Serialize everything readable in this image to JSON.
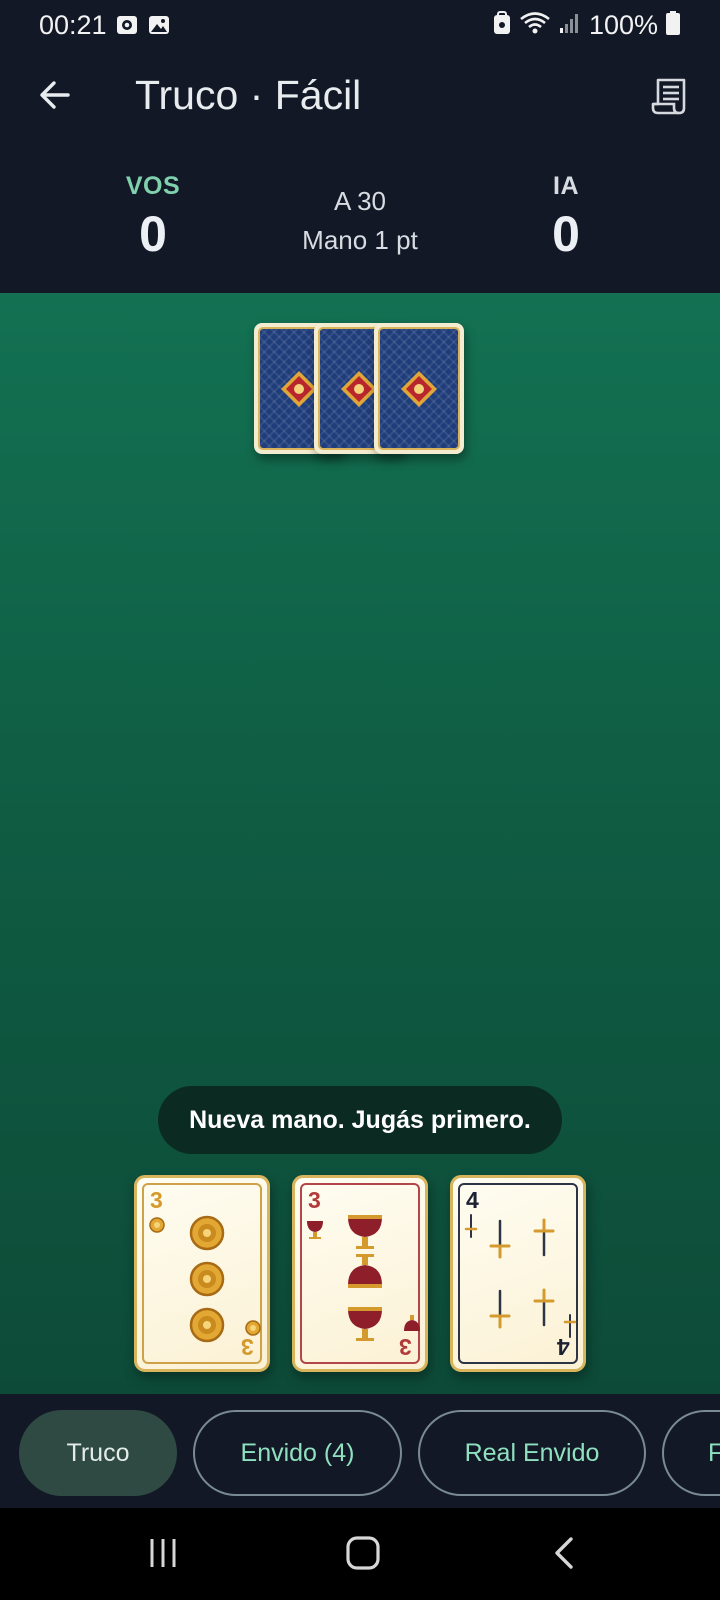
{
  "status_bar": {
    "time": "00:21",
    "battery": "100%",
    "icons": [
      "camera-notification-icon",
      "image-notification-icon",
      "vpn-lock-icon",
      "wifi-icon",
      "signal-icon",
      "battery-icon"
    ]
  },
  "app_bar": {
    "title": "Truco · Fácil",
    "back_icon": "arrow-left-icon",
    "log_icon": "receipt-log-icon"
  },
  "score": {
    "player_label": "VOS",
    "player_points": "0",
    "target": "A 30",
    "hand_value": "Mano 1 pt",
    "ai_label": "IA",
    "ai_points": "0"
  },
  "table": {
    "opponent_cards_count": 3,
    "message": "Nueva mano. Jugás primero."
  },
  "player_hand": [
    {
      "rank": "3",
      "suit": "oros",
      "color": "#d4992a"
    },
    {
      "rank": "3",
      "suit": "copas",
      "color": "#b23a3a"
    },
    {
      "rank": "4",
      "suit": "espadas",
      "color": "#1c2233"
    }
  ],
  "actions": [
    {
      "label": "Truco",
      "primary": true
    },
    {
      "label": "Envido (4)",
      "primary": false
    },
    {
      "label": "Real Envido",
      "primary": false
    },
    {
      "label": "F",
      "primary": false
    }
  ],
  "colors": {
    "felt_top": "#137152",
    "felt_bottom": "#0d4b38",
    "header_bg": "#121826",
    "accent_green": "#7fd1ae",
    "card_back_blue": "#1f3d7a",
    "card_back_diamond": "#b8262e",
    "card_border_gold": "#d8b45c"
  },
  "nav_bar": {
    "icons": [
      "recents-icon",
      "home-icon",
      "back-icon"
    ]
  }
}
